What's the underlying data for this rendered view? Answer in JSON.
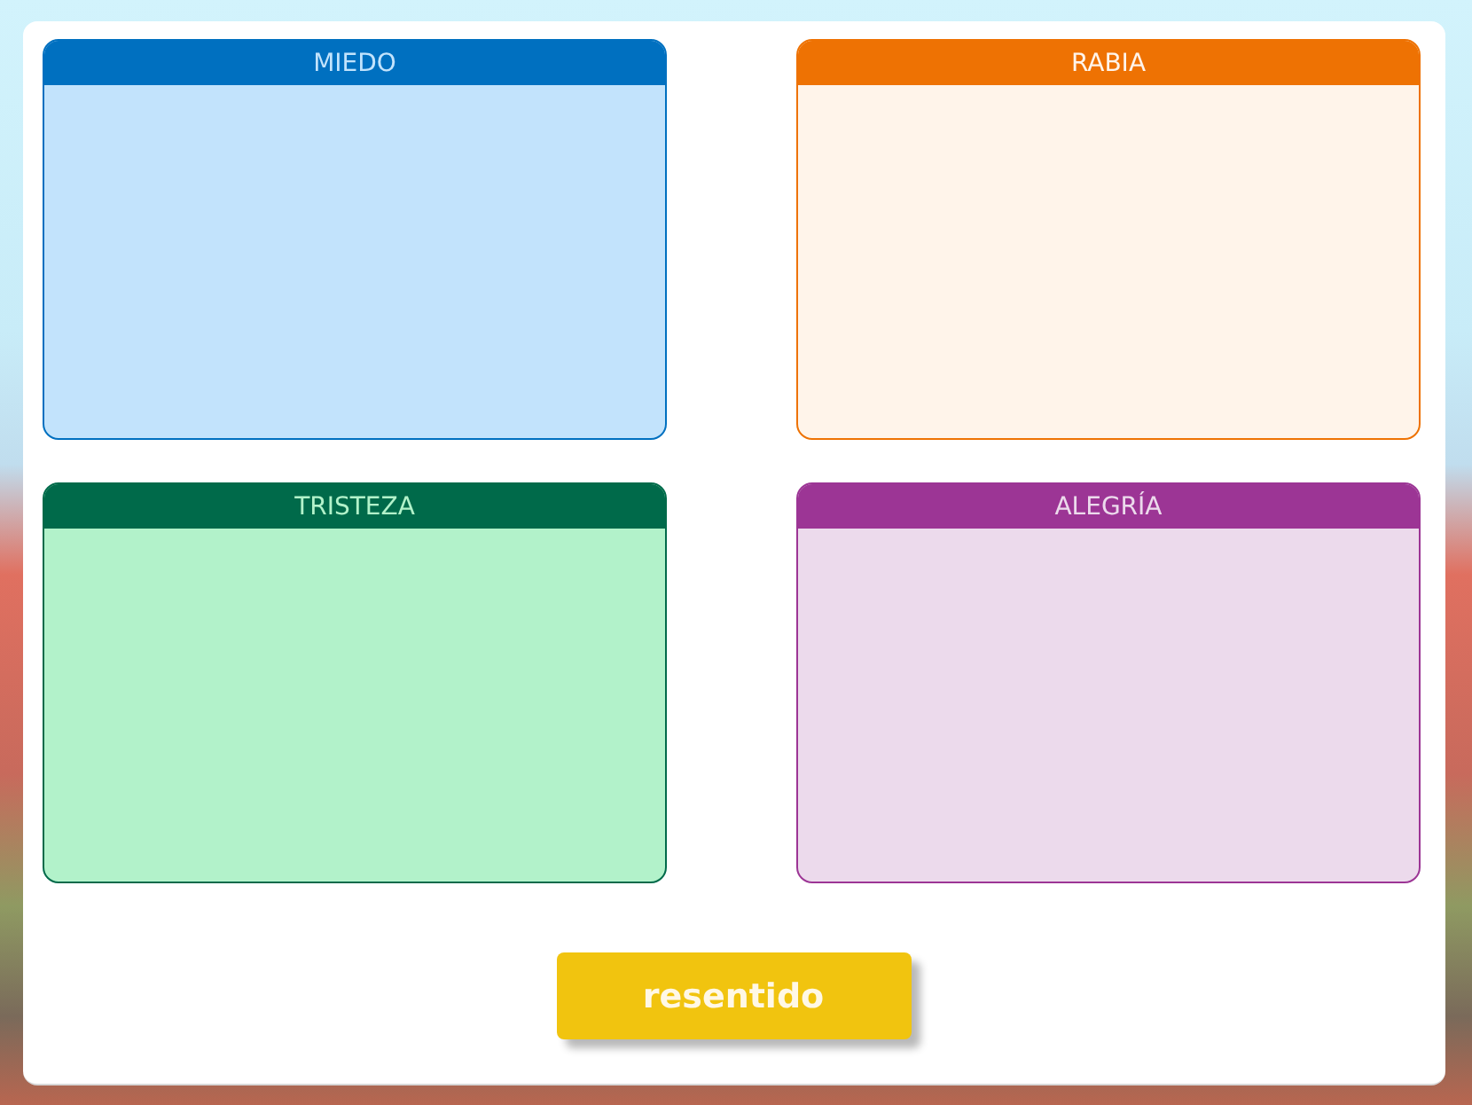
{
  "categories": [
    {
      "label": "MIEDO",
      "color": "#0070c0",
      "panel": {
        "color": "#c2e3fc"
      }
    },
    {
      "label": "RABIA",
      "color": "#ee7203",
      "panel": {
        "color": "#fff4ea"
      }
    },
    {
      "label": "TRISTEZA",
      "color": "#006a4a",
      "panel": {
        "color": "#b2f2ca"
      }
    },
    {
      "label": "ALEGRÍA",
      "color": "#9c3595",
      "panel": {
        "color": "#ecdaec"
      }
    }
  ],
  "word_card": {
    "label": "resentido"
  }
}
